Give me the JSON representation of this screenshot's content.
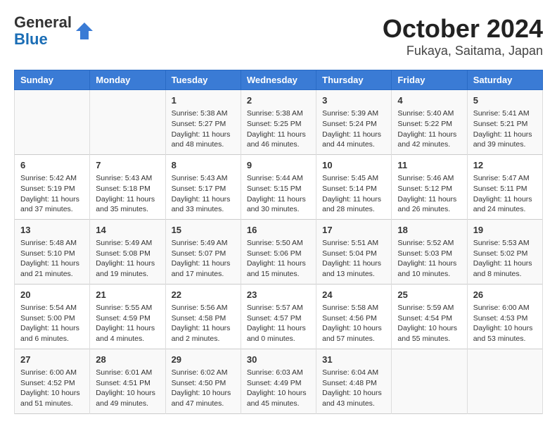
{
  "header": {
    "logo_general": "General",
    "logo_blue": "Blue",
    "title": "October 2024",
    "subtitle": "Fukaya, Saitama, Japan"
  },
  "days_of_week": [
    "Sunday",
    "Monday",
    "Tuesday",
    "Wednesday",
    "Thursday",
    "Friday",
    "Saturday"
  ],
  "weeks": [
    [
      {
        "day": "",
        "info": ""
      },
      {
        "day": "",
        "info": ""
      },
      {
        "day": "1",
        "info": "Sunrise: 5:38 AM\nSunset: 5:27 PM\nDaylight: 11 hours\nand 48 minutes."
      },
      {
        "day": "2",
        "info": "Sunrise: 5:38 AM\nSunset: 5:25 PM\nDaylight: 11 hours\nand 46 minutes."
      },
      {
        "day": "3",
        "info": "Sunrise: 5:39 AM\nSunset: 5:24 PM\nDaylight: 11 hours\nand 44 minutes."
      },
      {
        "day": "4",
        "info": "Sunrise: 5:40 AM\nSunset: 5:22 PM\nDaylight: 11 hours\nand 42 minutes."
      },
      {
        "day": "5",
        "info": "Sunrise: 5:41 AM\nSunset: 5:21 PM\nDaylight: 11 hours\nand 39 minutes."
      }
    ],
    [
      {
        "day": "6",
        "info": "Sunrise: 5:42 AM\nSunset: 5:19 PM\nDaylight: 11 hours\nand 37 minutes."
      },
      {
        "day": "7",
        "info": "Sunrise: 5:43 AM\nSunset: 5:18 PM\nDaylight: 11 hours\nand 35 minutes."
      },
      {
        "day": "8",
        "info": "Sunrise: 5:43 AM\nSunset: 5:17 PM\nDaylight: 11 hours\nand 33 minutes."
      },
      {
        "day": "9",
        "info": "Sunrise: 5:44 AM\nSunset: 5:15 PM\nDaylight: 11 hours\nand 30 minutes."
      },
      {
        "day": "10",
        "info": "Sunrise: 5:45 AM\nSunset: 5:14 PM\nDaylight: 11 hours\nand 28 minutes."
      },
      {
        "day": "11",
        "info": "Sunrise: 5:46 AM\nSunset: 5:12 PM\nDaylight: 11 hours\nand 26 minutes."
      },
      {
        "day": "12",
        "info": "Sunrise: 5:47 AM\nSunset: 5:11 PM\nDaylight: 11 hours\nand 24 minutes."
      }
    ],
    [
      {
        "day": "13",
        "info": "Sunrise: 5:48 AM\nSunset: 5:10 PM\nDaylight: 11 hours\nand 21 minutes."
      },
      {
        "day": "14",
        "info": "Sunrise: 5:49 AM\nSunset: 5:08 PM\nDaylight: 11 hours\nand 19 minutes."
      },
      {
        "day": "15",
        "info": "Sunrise: 5:49 AM\nSunset: 5:07 PM\nDaylight: 11 hours\nand 17 minutes."
      },
      {
        "day": "16",
        "info": "Sunrise: 5:50 AM\nSunset: 5:06 PM\nDaylight: 11 hours\nand 15 minutes."
      },
      {
        "day": "17",
        "info": "Sunrise: 5:51 AM\nSunset: 5:04 PM\nDaylight: 11 hours\nand 13 minutes."
      },
      {
        "day": "18",
        "info": "Sunrise: 5:52 AM\nSunset: 5:03 PM\nDaylight: 11 hours\nand 10 minutes."
      },
      {
        "day": "19",
        "info": "Sunrise: 5:53 AM\nSunset: 5:02 PM\nDaylight: 11 hours\nand 8 minutes."
      }
    ],
    [
      {
        "day": "20",
        "info": "Sunrise: 5:54 AM\nSunset: 5:00 PM\nDaylight: 11 hours\nand 6 minutes."
      },
      {
        "day": "21",
        "info": "Sunrise: 5:55 AM\nSunset: 4:59 PM\nDaylight: 11 hours\nand 4 minutes."
      },
      {
        "day": "22",
        "info": "Sunrise: 5:56 AM\nSunset: 4:58 PM\nDaylight: 11 hours\nand 2 minutes."
      },
      {
        "day": "23",
        "info": "Sunrise: 5:57 AM\nSunset: 4:57 PM\nDaylight: 11 hours\nand 0 minutes."
      },
      {
        "day": "24",
        "info": "Sunrise: 5:58 AM\nSunset: 4:56 PM\nDaylight: 10 hours\nand 57 minutes."
      },
      {
        "day": "25",
        "info": "Sunrise: 5:59 AM\nSunset: 4:54 PM\nDaylight: 10 hours\nand 55 minutes."
      },
      {
        "day": "26",
        "info": "Sunrise: 6:00 AM\nSunset: 4:53 PM\nDaylight: 10 hours\nand 53 minutes."
      }
    ],
    [
      {
        "day": "27",
        "info": "Sunrise: 6:00 AM\nSunset: 4:52 PM\nDaylight: 10 hours\nand 51 minutes."
      },
      {
        "day": "28",
        "info": "Sunrise: 6:01 AM\nSunset: 4:51 PM\nDaylight: 10 hours\nand 49 minutes."
      },
      {
        "day": "29",
        "info": "Sunrise: 6:02 AM\nSunset: 4:50 PM\nDaylight: 10 hours\nand 47 minutes."
      },
      {
        "day": "30",
        "info": "Sunrise: 6:03 AM\nSunset: 4:49 PM\nDaylight: 10 hours\nand 45 minutes."
      },
      {
        "day": "31",
        "info": "Sunrise: 6:04 AM\nSunset: 4:48 PM\nDaylight: 10 hours\nand 43 minutes."
      },
      {
        "day": "",
        "info": ""
      },
      {
        "day": "",
        "info": ""
      }
    ]
  ]
}
